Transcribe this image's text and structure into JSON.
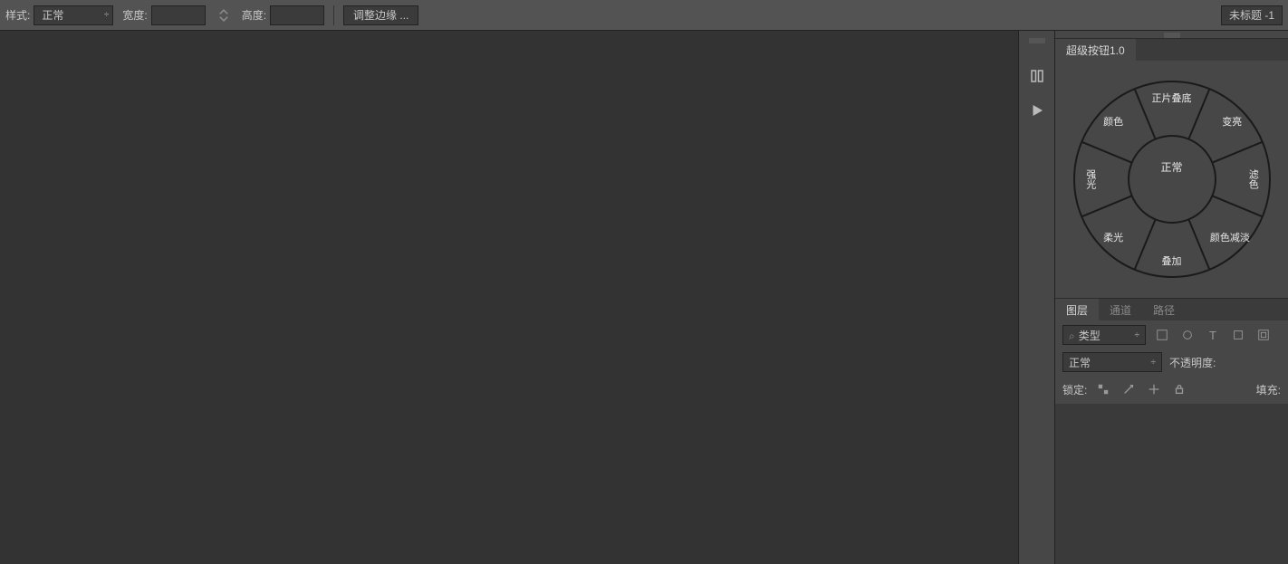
{
  "options": {
    "style_label": "样式:",
    "style_value": "正常",
    "width_label": "宽度:",
    "width_value": "",
    "height_label": "高度:",
    "height_value": "",
    "adjust_edges_label": "调整边缘 ..."
  },
  "document": {
    "title": "未标题 -1"
  },
  "super_button": {
    "tab_label": "超级按钮1.0",
    "center": "正常",
    "wedges": [
      {
        "label": "正片叠底",
        "angle": -90
      },
      {
        "label": "变亮",
        "angle": -45
      },
      {
        "label": "滤色",
        "angle": 0
      },
      {
        "label": "颜色减淡",
        "angle": 45
      },
      {
        "label": "叠加",
        "angle": 90
      },
      {
        "label": "柔光",
        "angle": 135
      },
      {
        "label": "强光",
        "angle": 180
      },
      {
        "label": "颜色",
        "angle": 225
      }
    ]
  },
  "layers_panel": {
    "tabs": {
      "layers": "图层",
      "channels": "通道",
      "paths": "路径"
    },
    "filter_kind": "类型",
    "blend_mode": "正常",
    "opacity_label": "不透明度:",
    "lock_label": "锁定:",
    "fill_label": "填充:"
  }
}
